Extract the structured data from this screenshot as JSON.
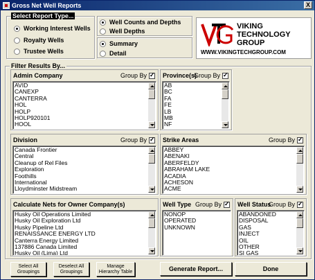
{
  "window": {
    "title": "Gross Net Well Reports",
    "close_label": "X"
  },
  "report_type": {
    "label": "Select Report Type...",
    "options": [
      "Working Interest Wells",
      "Royalty Wells",
      "Trustee Wells"
    ],
    "selected": "Working Interest Wells"
  },
  "well_option": {
    "options": [
      "Well Counts and Depths",
      "Well Depths"
    ],
    "selected": "Well Counts and Depths"
  },
  "detail_option": {
    "options": [
      "Summary",
      "Detail"
    ],
    "selected": "Summary"
  },
  "logo": {
    "line1": "VIKING",
    "line2": "TECHNOLOGY",
    "line3": "GROUP",
    "url": "WWW.VIKINGTECHGROUP.COM"
  },
  "filter": {
    "label": "Filter Results By..."
  },
  "group_by_label": "Group By",
  "admin_company": {
    "title": "Admin Company",
    "group_by": true,
    "items": [
      "AVID",
      "CANEXP",
      "CANTERRA",
      "HOL",
      "HOLP",
      "HOLP920101",
      "HOOL"
    ]
  },
  "provinces": {
    "title": "Province(s)",
    "group_by": true,
    "items": [
      "AB",
      "BC",
      "FA",
      "FE",
      "LB",
      "MB",
      "NF"
    ]
  },
  "division": {
    "title": "Division",
    "group_by": true,
    "items": [
      "Canada Frontier",
      "Central",
      "Cleanup of Rel Files",
      "Exploration",
      "Foothills",
      "International",
      "Lloydminster Midstream"
    ]
  },
  "strike_areas": {
    "title": "Strike Areas",
    "group_by": true,
    "items": [
      "ABBEY",
      "ABENAKI",
      "ABERFELDY",
      "ABRAHAM LAKE",
      "ACADIA",
      "ACHESON",
      "ACME"
    ]
  },
  "owner_nets": {
    "title": "Calculate Nets for Owner Company(s)",
    "items": [
      "Husky Oil Operations Limited",
      "Husky Oil Exploration Ltd",
      "Husky Pipeline Ltd",
      "RENAISSANCE ENERGY LTD",
      "Canterra Energy Limited",
      "137886 Canada Limited",
      "Husky Oil (Lima) Ltd"
    ]
  },
  "well_type": {
    "title": "Well Type",
    "group_by": true,
    "items": [
      "NONOP",
      "OPERATED",
      "UNKNOWN"
    ]
  },
  "well_status": {
    "title": "Well Status",
    "group_by": true,
    "items": [
      "ABANDONED",
      "DISPOSAL",
      "GAS",
      "INJECT",
      "OIL",
      "OTHER",
      "SI GAS"
    ]
  },
  "buttons": {
    "select_all": "Select All Groupings",
    "deselect_all": "Deselect All Groupings",
    "manage": "Manage Hierarchy Table",
    "generate": "Generate Report...",
    "done": "Done"
  },
  "colors": {
    "titlebar": "#0a246a",
    "background": "#ece9d8"
  }
}
